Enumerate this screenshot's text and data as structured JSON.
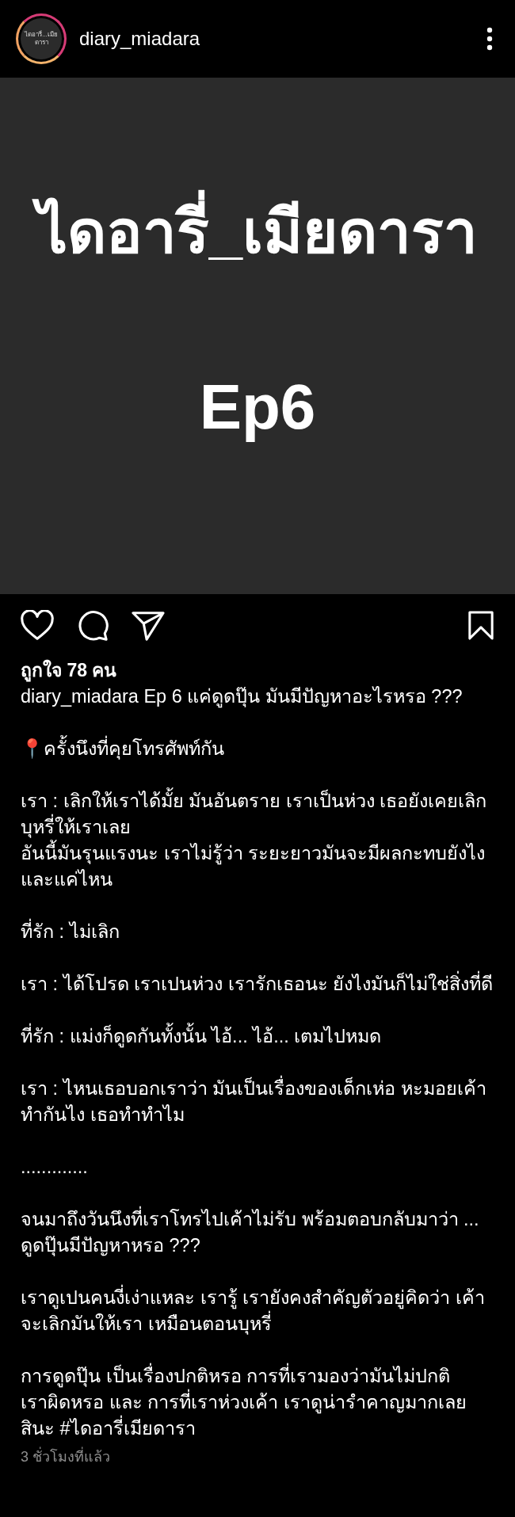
{
  "header": {
    "avatar_text": "ไดอารี่...เมียดารา",
    "username": "diary_miadara"
  },
  "post_image": {
    "title": "ไดอารี่_เมียดารา",
    "subtitle": "Ep6"
  },
  "actions": {
    "liked": false,
    "saved": false
  },
  "likes": "ถูกใจ 78 คน",
  "caption": {
    "username": "diary_miadara",
    "paragraphs": [
      [
        "Ep 6 แค่ดูดปุ๊น มันมีปัญหาอะไรหรอ ???"
      ],
      [
        "📍ครั้งนึงที่คุยโทรศัพท์กัน"
      ],
      [
        "เรา : เลิกให้เราได้มั้ย มันอันตราย เราเป็นห่วง เธอยังเคยเลิกบุหรี่ให้เราเลย",
        "อันนี้มันรุนแรงนะ เราไม่รู้ว่า ระยะยาวมันจะมีผลกะทบยังไงและแค่ไหน"
      ],
      [
        "ที่รัก : ไม่เลิก"
      ],
      [
        "เรา : ได้โปรด เราเปนห่วง เรารักเธอนะ ยังไงมันก็ไม่ใช่สิ่งที่ดี"
      ],
      [
        "ที่รัก : แม่งก็ดูดกันทั้งนั้น ไอ้... ไอ้... เตมไปหมด"
      ],
      [
        "เรา : ไหนเธอบอกเราว่า มันเป็นเรื่องของเด็กเห่อ หะมอยเค้าทำกันไง เธอทำทำไม"
      ],
      [
        "............."
      ],
      [
        "จนมาถึงวันนึงที่เราโทรไปเค้าไม่รับ พร้อมตอบกลับมาว่า ... ดูดปุ๊นมีปัญหาหรอ ???"
      ],
      [
        "เราดูเปนคนงี่เง่าแหละ เรารู้ เรายังคงสำคัญตัวอยู่คิดว่า เค้าจะเลิกมันให้เรา เหมือนตอนบุหรี่"
      ],
      [
        "การดูดปุ๊น เป็นเรื่องปกติหรอ การที่เรามองว่ามันไม่ปกติ",
        "เราผิดหรอ และ การที่เราห่วงเค้า เราดูน่ารำคาญมากเลยสินะ #ไดอารี่เมียดารา"
      ]
    ]
  },
  "timestamp": "3 ชั่วโมงที่แล้ว"
}
